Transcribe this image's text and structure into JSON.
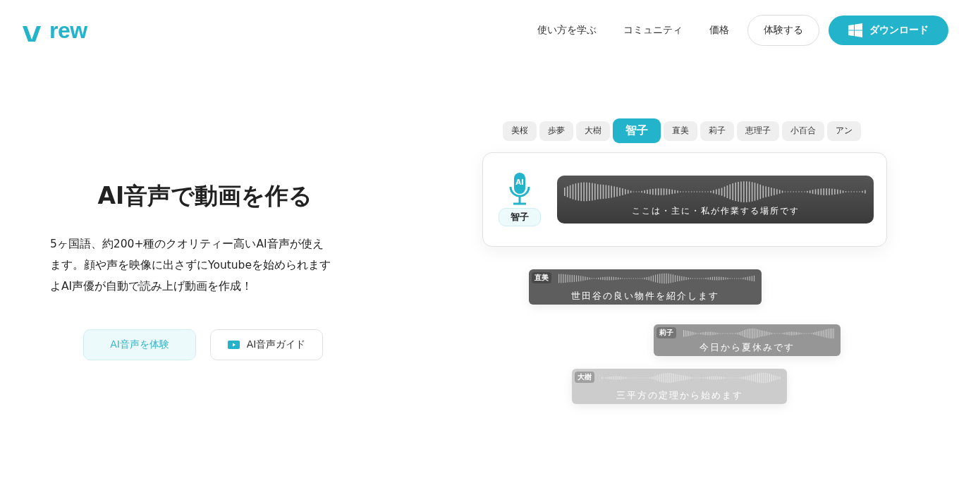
{
  "header": {
    "logo": {
      "text": "rew"
    },
    "nav": [
      "使い方を学ぶ",
      "コミュニティ",
      "価格"
    ],
    "try_button": "体験する",
    "download_button": "ダウンロード"
  },
  "hero": {
    "title": "AI音声で動画を作る",
    "description": [
      "5ヶ国語、約200+種のクオリティー高いAI音声が使え",
      "ます。顔や声を映像に出さずにYoutubeを始められます",
      "よAI声優が自動で読み上げ動画を作成！"
    ],
    "buttons": [
      {
        "kind": "primary",
        "label": "AI音声を体験"
      },
      {
        "kind": "video",
        "label": "AI音声ガイド"
      }
    ]
  },
  "demo": {
    "voices": [
      {
        "label": "美桜",
        "selected": false
      },
      {
        "label": "歩夢",
        "selected": false
      },
      {
        "label": "大樹",
        "selected": false
      },
      {
        "label": "智子",
        "selected": true
      },
      {
        "label": "直美",
        "selected": false
      },
      {
        "label": "莉子",
        "selected": false
      },
      {
        "label": "恵理子",
        "selected": false
      },
      {
        "label": "小百合",
        "selected": false
      },
      {
        "label": "アン",
        "selected": false
      }
    ],
    "current": {
      "mic_label": "AI",
      "speaker": "智子",
      "caption": "ここは・主に・私が作業する場所です"
    },
    "clips": [
      {
        "speaker": "直美",
        "caption": "世田谷の良い物件を紹介します",
        "color": "#5e5e5e"
      },
      {
        "speaker": "莉子",
        "caption": "今日から夏休みです",
        "color": "#969696"
      },
      {
        "speaker": "大樹",
        "caption": "三平方の定理から始めます",
        "color": "#cccccc"
      }
    ]
  }
}
